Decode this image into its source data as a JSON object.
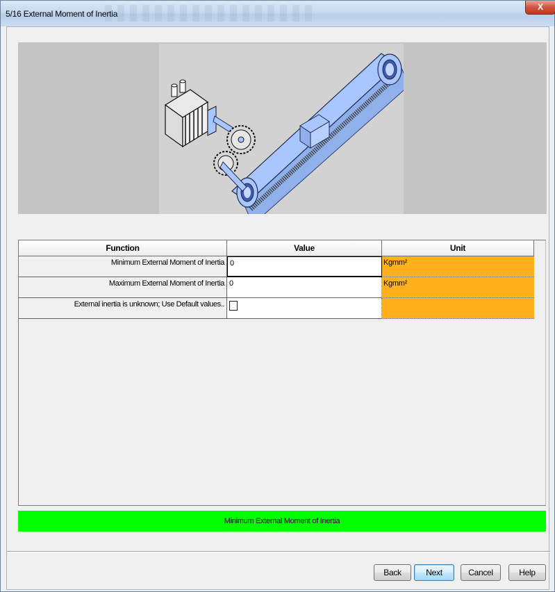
{
  "window": {
    "title": "5/16 External Moment of Inertia",
    "close_label": "X"
  },
  "table": {
    "columns": [
      "Function",
      "Value",
      "Unit"
    ],
    "rows": [
      {
        "function": "Minimum External Moment of Inertia",
        "value": "0",
        "unit": "Kgmm²"
      },
      {
        "function": "Maximum External Moment of Inertia",
        "value": "0",
        "unit": "Kgmm²"
      },
      {
        "function": "External inertia is unknown; Use Default values..",
        "value_checkbox_checked": false,
        "unit": ""
      }
    ]
  },
  "status": {
    "text": "Minimum External Moment of Inertia",
    "color": "#00ff00"
  },
  "buttons": {
    "back": "Back",
    "next": "Next",
    "cancel": "Cancel",
    "help": "Help"
  },
  "colors": {
    "unit_cell": "#ffb21e",
    "belt": "#a9c6ff"
  },
  "icons": {
    "illustration": "motor-gear-belt-drive-illustration"
  }
}
